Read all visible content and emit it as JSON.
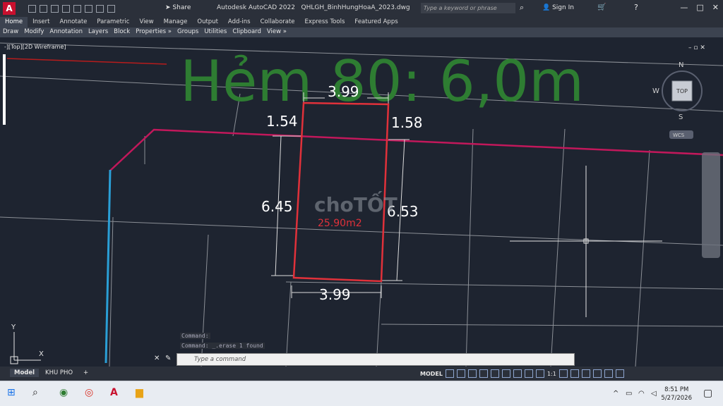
{
  "titlebar": {
    "logo_letter": "A",
    "share_label": "Share",
    "app_title": "Autodesk AutoCAD 2022",
    "file_name": "QHLGH_BinhHungHoaA_2023.dwg",
    "search_placeholder": "Type a keyword or phrase",
    "sign_in_label": "Sign In"
  },
  "ribbon": {
    "tabs": [
      "Home",
      "Insert",
      "Annotate",
      "Parametric",
      "View",
      "Manage",
      "Output",
      "Add-ins",
      "Collaborate",
      "Express Tools",
      "Featured Apps"
    ],
    "active_tab": "Home",
    "panels": [
      "Draw",
      "Modify",
      "Annotation",
      "Layers",
      "Block",
      "Properties »",
      "Groups",
      "Utilities",
      "Clipboard",
      "View »"
    ]
  },
  "viewport": {
    "label": "-][Top][2D Wireframe]",
    "big_text": "Hẻm 80: 6,0m",
    "area_label": "25.90m2",
    "watermark": "choTỐT",
    "dimensions": {
      "top": "3.99",
      "bottom": "3.99",
      "left": "6.45",
      "right": "6.53",
      "top_left": "1.54",
      "top_right": "1.58"
    },
    "viewcube": {
      "n": "N",
      "s": "S",
      "w": "W",
      "top": "TOP",
      "wcs": "WCS"
    },
    "ucs": {
      "x": "X",
      "y": "Y"
    }
  },
  "command": {
    "history_1": "Command:",
    "history_2": "Command: _.erase 1 found",
    "placeholder": "Type a command"
  },
  "layout_tabs": [
    "Model",
    "KHU PHO",
    "+"
  ],
  "status": {
    "model_label": "MODEL",
    "scale": "1:1"
  },
  "taskbar": {
    "time": "8:51 PM",
    "date": "5/27/2026"
  },
  "colors": {
    "accent": "#2e7d32",
    "parcel_red": "#e0313a",
    "road_magenta": "#c2185b",
    "blue_line": "#2a9fd6"
  }
}
